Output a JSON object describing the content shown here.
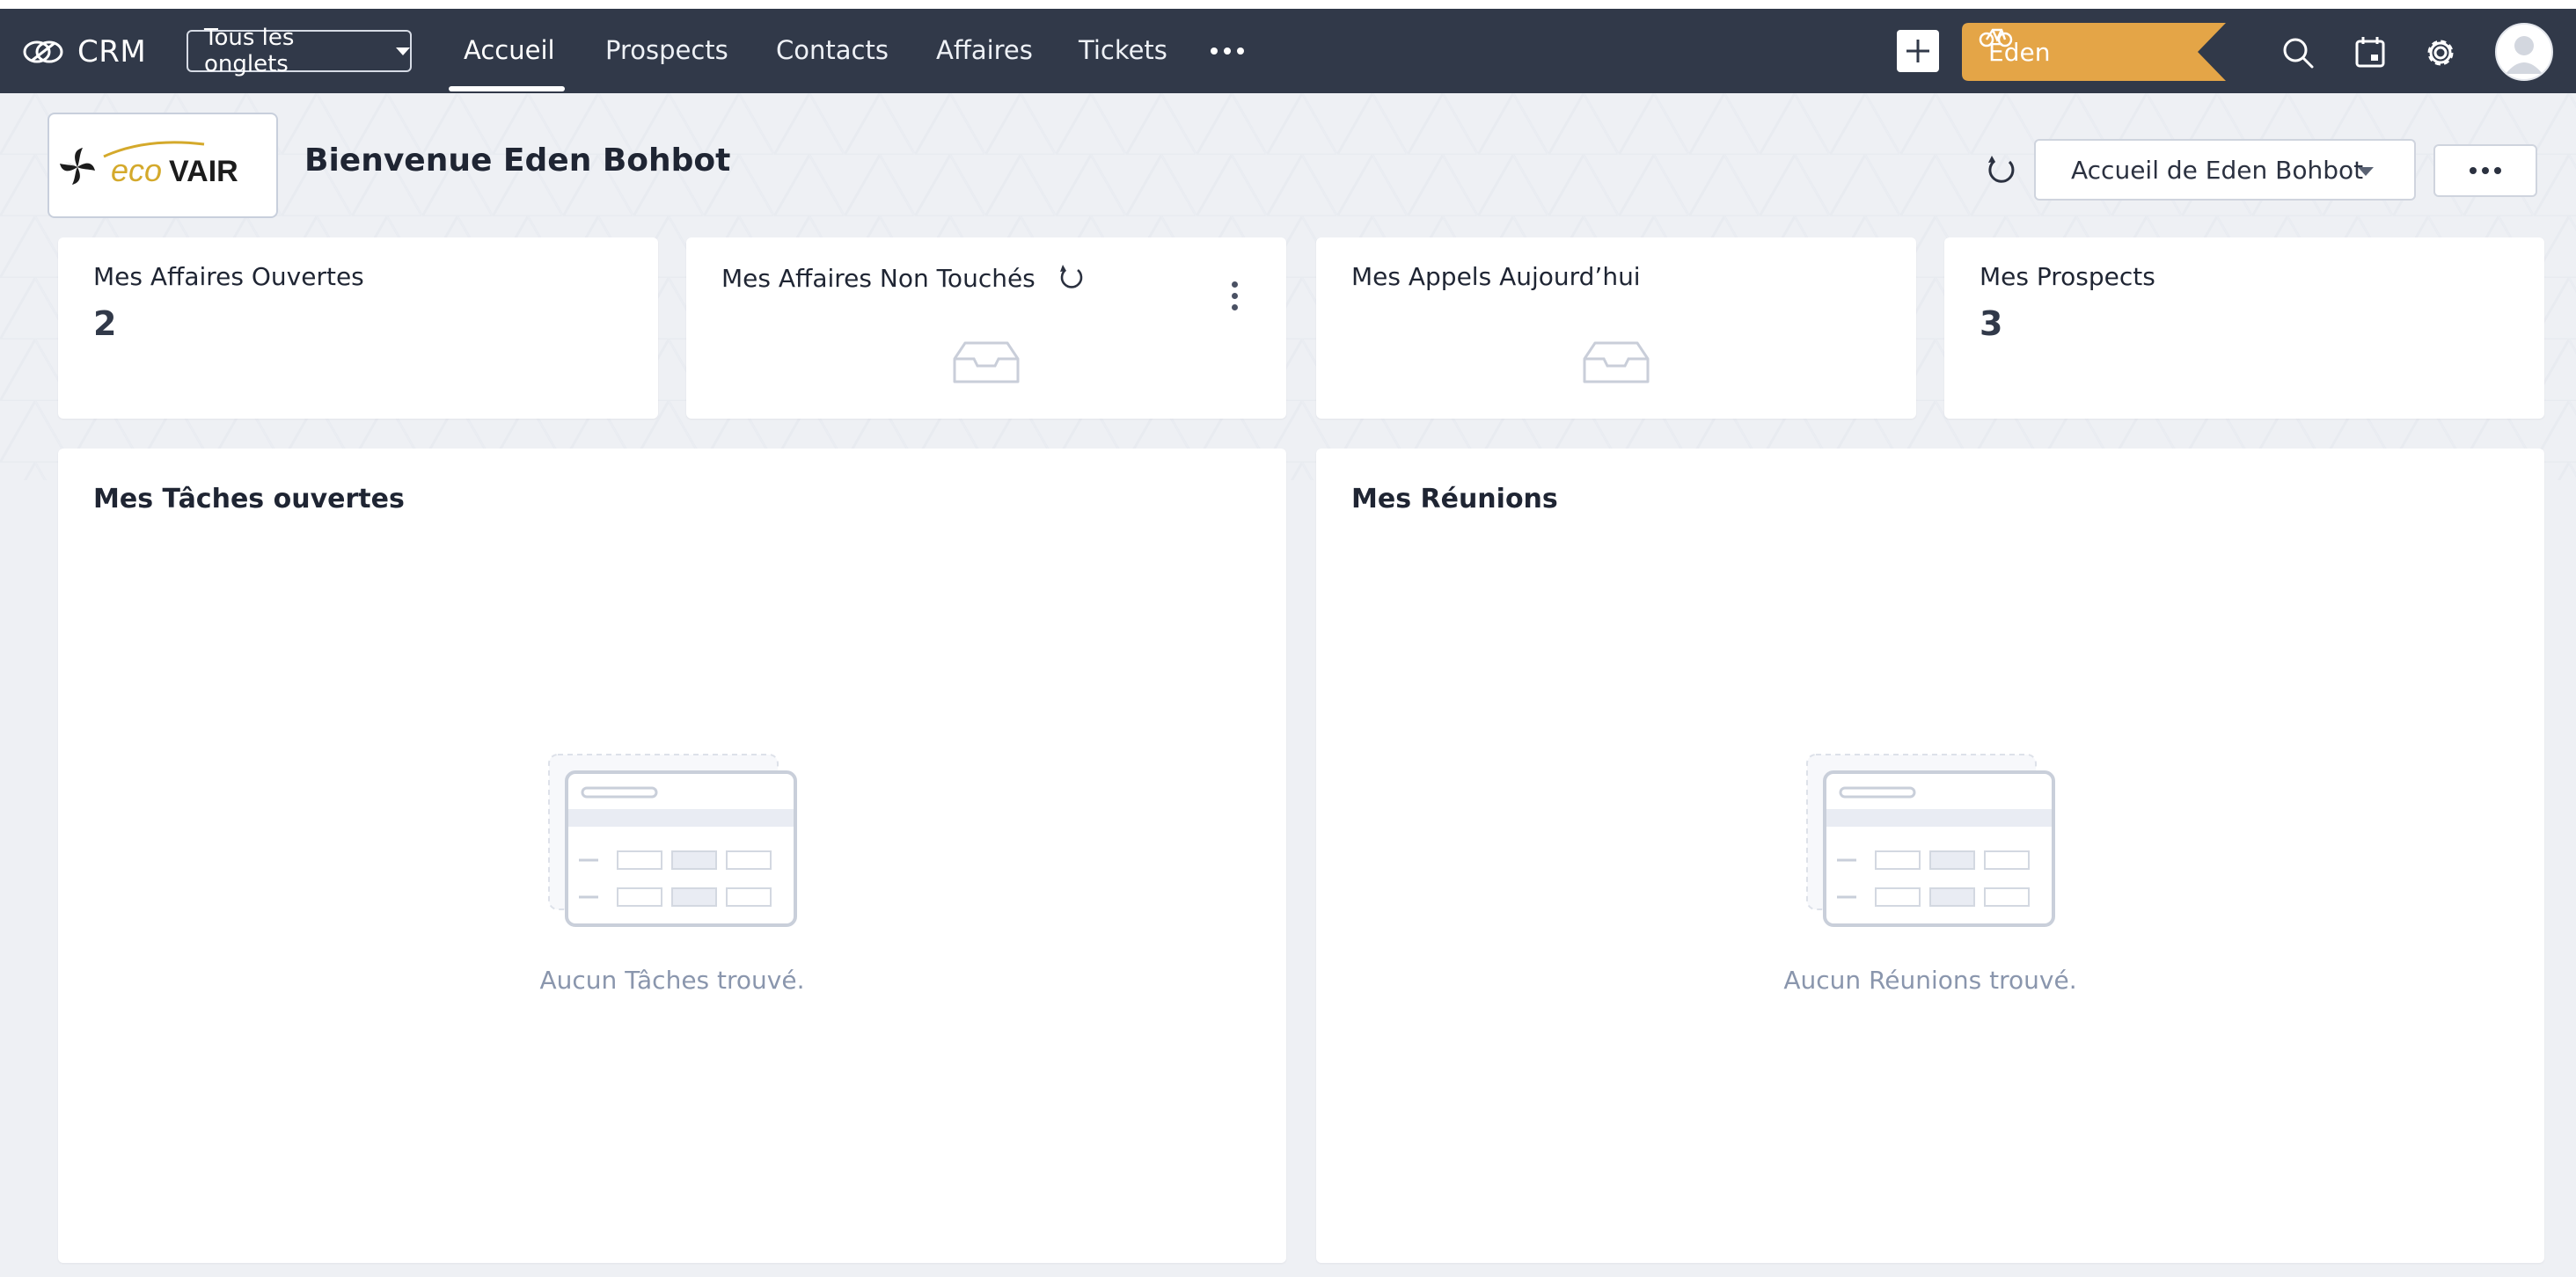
{
  "navbar": {
    "brand": "CRM",
    "tabs_select": "Tous les onglets",
    "items": [
      {
        "label": "Accueil",
        "active": true
      },
      {
        "label": "Prospects"
      },
      {
        "label": "Contacts"
      },
      {
        "label": "Affaires"
      },
      {
        "label": "Tickets"
      }
    ],
    "more_icon": "more-horizontal-icon",
    "add_icon": "plus-icon",
    "user_ribbon": "Eden",
    "icons": [
      "search-icon",
      "calendar-icon",
      "gear-icon"
    ],
    "colors": {
      "bar": "#313949",
      "ribbon": "#e4a547"
    }
  },
  "header": {
    "logo_text": "ECOVAIR",
    "welcome": "Bienvenue Eden Bohbot",
    "home_select": "Accueil de Eden Bohbot"
  },
  "kpis": [
    {
      "title": "Mes Affaires Ouvertes",
      "value": "2"
    },
    {
      "title": "Mes Affaires Non Touchés",
      "value": ""
    },
    {
      "title": "Mes Appels Aujourd’hui",
      "value": ""
    },
    {
      "title": "Mes Prospects",
      "value": "3"
    }
  ],
  "panels": [
    {
      "title": "Mes Tâches ouvertes",
      "empty": "Aucun Tâches trouvé."
    },
    {
      "title": "Mes Réunions",
      "empty": "Aucun Réunions trouvé."
    }
  ]
}
